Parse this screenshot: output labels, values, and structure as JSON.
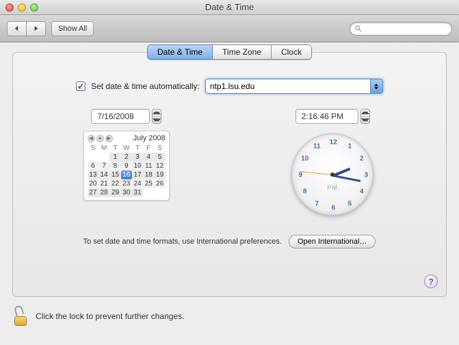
{
  "window": {
    "title": "Date & Time"
  },
  "toolbar": {
    "show_all": "Show All",
    "search_placeholder": ""
  },
  "tabs": {
    "date_time": "Date & Time",
    "time_zone": "Time Zone",
    "clock": "Clock"
  },
  "auto": {
    "checked": true,
    "label": "Set date & time automatically:",
    "server": "ntp1.lsu.edu"
  },
  "date_field": "7/16/2008",
  "time_field": "2:16:46 PM",
  "calendar": {
    "month_label": "July 2008",
    "dow": [
      "S",
      "M",
      "T",
      "W",
      "T",
      "F",
      "S"
    ],
    "weeks": [
      [
        "",
        "",
        "1",
        "2",
        "3",
        "4",
        "5"
      ],
      [
        "6",
        "7",
        "8",
        "9",
        "10",
        "11",
        "12"
      ],
      [
        "13",
        "14",
        "15",
        "16",
        "17",
        "18",
        "19"
      ],
      [
        "20",
        "21",
        "22",
        "23",
        "24",
        "25",
        "26"
      ],
      [
        "27",
        "28",
        "29",
        "30",
        "31",
        "",
        ""
      ]
    ],
    "selected": "16"
  },
  "clock": {
    "ampm": "PM",
    "hour_angle": -22,
    "minute_angle": 7,
    "second_angle": 186,
    "numbers": [
      "12",
      "1",
      "2",
      "3",
      "4",
      "5",
      "6",
      "7",
      "8",
      "9",
      "10",
      "11"
    ]
  },
  "footer": {
    "text": "To set date and time formats, use International preferences.",
    "button": "Open International…"
  },
  "lock": {
    "text": "Click the lock to prevent further changes."
  }
}
